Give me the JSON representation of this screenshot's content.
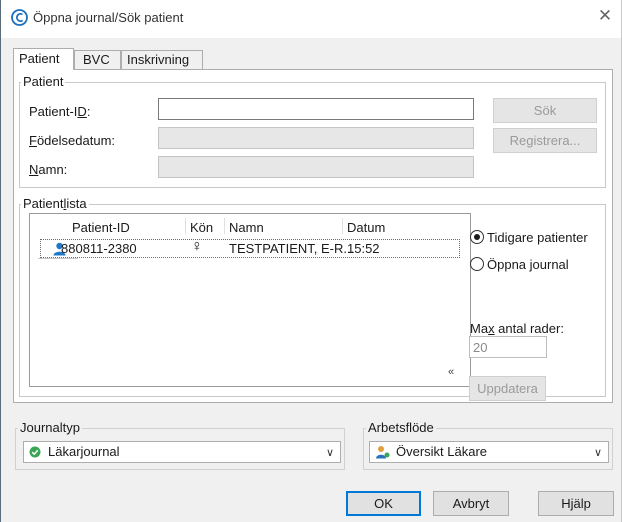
{
  "window": {
    "title": "Öppna journal/Sök patient",
    "close_glyph": "✕"
  },
  "tabs": [
    {
      "label": "Patient",
      "active": true
    },
    {
      "label": "BVC",
      "active": false
    },
    {
      "label": "Inskrivning",
      "active": false
    }
  ],
  "patient_group": {
    "title": "Patient",
    "patient_id_label": "Patient-I",
    "patient_id_label_u": "D",
    "patient_id_label_suffix": ":",
    "patient_id_value": "",
    "birthdate_label_u": "F",
    "birthdate_label_rest": "ödelsedatum:",
    "birthdate_value": "",
    "name_label_u": "N",
    "name_label_rest": "amn:",
    "name_value": "",
    "search_button": "Sök",
    "register_button": "Registrera..."
  },
  "patientlist": {
    "title_prefix": "Patient",
    "title_u": "l",
    "title_suffix": "ista",
    "columns": [
      "Patient-ID",
      "Kön",
      "Namn",
      "Datum"
    ],
    "rows": [
      {
        "patient_id": "880811-2380",
        "gender_symbol": "♀",
        "name": "TESTPATIENT, E-R...",
        "date": "15:52",
        "icon": "person-icon"
      }
    ],
    "radio_previous": "Tidigare patienter",
    "radio_open": "Öppna journal",
    "selected_radio": "previous",
    "max_rows_label_pre": "Ma",
    "max_rows_label_u": "x",
    "max_rows_label_post": " antal rader:",
    "max_rows_value": "20",
    "update_button": "Uppdatera",
    "collapse_glyph": "«"
  },
  "journaltyp": {
    "title": "Journaltyp",
    "value": "Läkarjournal",
    "icon": "check-circle-icon"
  },
  "arbetsflode": {
    "title": "Arbetsflöde",
    "value": "Översikt Läkare",
    "icon": "doctor-icon"
  },
  "buttons": {
    "ok": "OK",
    "cancel": "Avbryt",
    "help": "Hjälp"
  },
  "colors": {
    "accent": "#0078d7",
    "icon_blue": "#1e78c8",
    "icon_green": "#3aa655"
  }
}
